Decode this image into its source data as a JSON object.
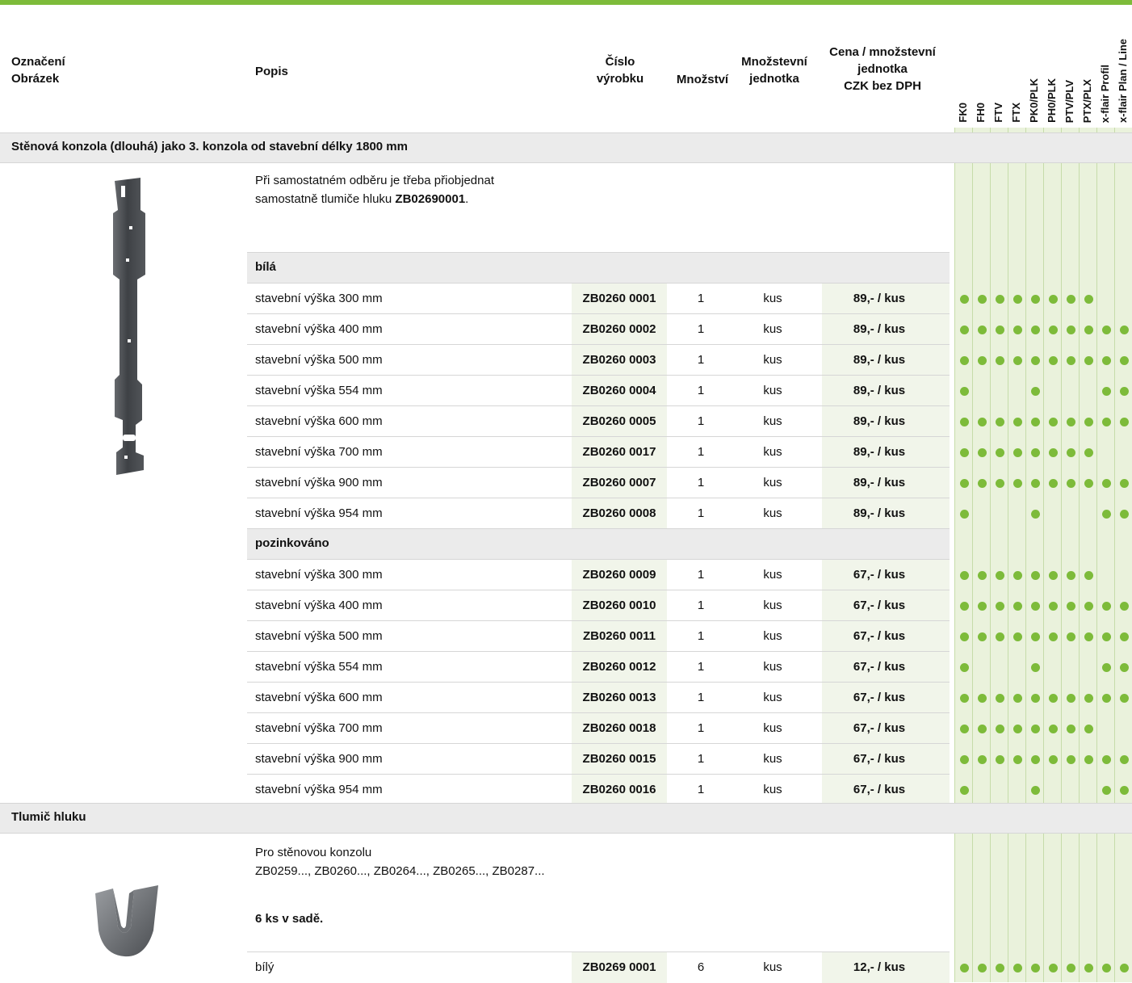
{
  "header": {
    "oznaceni": "Označení",
    "obrazek": "Obrázek",
    "popis": "Popis",
    "cislo_1": "Číslo",
    "cislo_2": "výrobku",
    "mnozstvi": "Množství",
    "mj_1": "Množstevní",
    "mj_2": "jednotka",
    "cena_1": "Cena / množstevní",
    "cena_2": "jednotka",
    "cena_3": "CZK bez DPH",
    "columns": [
      "FK0",
      "FH0",
      "FTV",
      "FTX",
      "PK0/PLK",
      "PH0/PLK",
      "PTV/PLV",
      "PTX/PLX",
      "x-flair Profil",
      "x-flair Plan / Line"
    ]
  },
  "colors": {
    "accent": "#7dbb3a",
    "section_bg": "#ebebeb",
    "grid_bg": "#eaf2dc"
  },
  "section1": {
    "title": "Stěnová konzola (dlouhá) jako 3. konzola od stavební délky 1800 mm",
    "image": "wall-bracket-long",
    "desc_1": "Při samostatném odběru je třeba přiobjednat",
    "desc_2a": "samostatně tlumiče hluku ",
    "desc_2b": "ZB02690001",
    "desc_2c": ".",
    "groups": [
      {
        "label": "bílá",
        "rows": [
          {
            "popis": "stavební výška 300 mm",
            "cislo": "ZB0260 0001",
            "mn": "1",
            "mj": "kus",
            "cena": "89,- / kus",
            "dots": [
              1,
              1,
              1,
              1,
              1,
              1,
              1,
              1,
              0,
              0
            ]
          },
          {
            "popis": "stavební výška 400 mm",
            "cislo": "ZB0260 0002",
            "mn": "1",
            "mj": "kus",
            "cena": "89,- / kus",
            "dots": [
              1,
              1,
              1,
              1,
              1,
              1,
              1,
              1,
              1,
              1
            ]
          },
          {
            "popis": "stavební výška 500 mm",
            "cislo": "ZB0260 0003",
            "mn": "1",
            "mj": "kus",
            "cena": "89,- / kus",
            "dots": [
              1,
              1,
              1,
              1,
              1,
              1,
              1,
              1,
              1,
              1
            ]
          },
          {
            "popis": "stavební výška 554 mm",
            "cislo": "ZB0260 0004",
            "mn": "1",
            "mj": "kus",
            "cena": "89,- / kus",
            "dots": [
              1,
              0,
              0,
              0,
              1,
              0,
              0,
              0,
              1,
              1
            ]
          },
          {
            "popis": "stavební výška 600 mm",
            "cislo": "ZB0260 0005",
            "mn": "1",
            "mj": "kus",
            "cena": "89,- / kus",
            "dots": [
              1,
              1,
              1,
              1,
              1,
              1,
              1,
              1,
              1,
              1
            ]
          },
          {
            "popis": "stavební výška 700 mm",
            "cislo": "ZB0260 0017",
            "mn": "1",
            "mj": "kus",
            "cena": "89,- / kus",
            "dots": [
              1,
              1,
              1,
              1,
              1,
              1,
              1,
              1,
              0,
              0
            ]
          },
          {
            "popis": "stavební výška 900 mm",
            "cislo": "ZB0260 0007",
            "mn": "1",
            "mj": "kus",
            "cena": "89,- / kus",
            "dots": [
              1,
              1,
              1,
              1,
              1,
              1,
              1,
              1,
              1,
              1
            ]
          },
          {
            "popis": "stavební výška 954 mm",
            "cislo": "ZB0260 0008",
            "mn": "1",
            "mj": "kus",
            "cena": "89,- / kus",
            "dots": [
              1,
              0,
              0,
              0,
              1,
              0,
              0,
              0,
              1,
              1
            ]
          }
        ]
      },
      {
        "label": "pozinkováno",
        "rows": [
          {
            "popis": "stavební výška 300 mm",
            "cislo": "ZB0260 0009",
            "mn": "1",
            "mj": "kus",
            "cena": "67,- / kus",
            "dots": [
              1,
              1,
              1,
              1,
              1,
              1,
              1,
              1,
              0,
              0
            ]
          },
          {
            "popis": "stavební výška 400 mm",
            "cislo": "ZB0260 0010",
            "mn": "1",
            "mj": "kus",
            "cena": "67,- / kus",
            "dots": [
              1,
              1,
              1,
              1,
              1,
              1,
              1,
              1,
              1,
              1
            ]
          },
          {
            "popis": "stavební výška 500 mm",
            "cislo": "ZB0260 0011",
            "mn": "1",
            "mj": "kus",
            "cena": "67,- / kus",
            "dots": [
              1,
              1,
              1,
              1,
              1,
              1,
              1,
              1,
              1,
              1
            ]
          },
          {
            "popis": "stavební výška 554 mm",
            "cislo": "ZB0260 0012",
            "mn": "1",
            "mj": "kus",
            "cena": "67,- / kus",
            "dots": [
              1,
              0,
              0,
              0,
              1,
              0,
              0,
              0,
              1,
              1
            ]
          },
          {
            "popis": "stavební výška 600 mm",
            "cislo": "ZB0260 0013",
            "mn": "1",
            "mj": "kus",
            "cena": "67,- / kus",
            "dots": [
              1,
              1,
              1,
              1,
              1,
              1,
              1,
              1,
              1,
              1
            ]
          },
          {
            "popis": "stavební výška 700 mm",
            "cislo": "ZB0260 0018",
            "mn": "1",
            "mj": "kus",
            "cena": "67,- / kus",
            "dots": [
              1,
              1,
              1,
              1,
              1,
              1,
              1,
              1,
              0,
              0
            ]
          },
          {
            "popis": "stavební výška 900 mm",
            "cislo": "ZB0260 0015",
            "mn": "1",
            "mj": "kus",
            "cena": "67,- / kus",
            "dots": [
              1,
              1,
              1,
              1,
              1,
              1,
              1,
              1,
              1,
              1
            ]
          },
          {
            "popis": "stavební výška 954 mm",
            "cislo": "ZB0260 0016",
            "mn": "1",
            "mj": "kus",
            "cena": "67,- / kus",
            "dots": [
              1,
              0,
              0,
              0,
              1,
              0,
              0,
              0,
              1,
              1
            ]
          }
        ]
      }
    ]
  },
  "section2": {
    "title": "Tlumič hluku",
    "image": "noise-damper",
    "desc_1": "Pro stěnovou konzolu",
    "desc_2": "ZB0259..., ZB0260..., ZB0264..., ZB0265..., ZB0287...",
    "desc_3": "6 ks v sadě.",
    "rows": [
      {
        "popis": "bílý",
        "cislo": "ZB0269 0001",
        "mn": "6",
        "mj": "kus",
        "cena": "12,- / kus",
        "dots": [
          1,
          1,
          1,
          1,
          1,
          1,
          1,
          1,
          1,
          1
        ]
      }
    ]
  }
}
